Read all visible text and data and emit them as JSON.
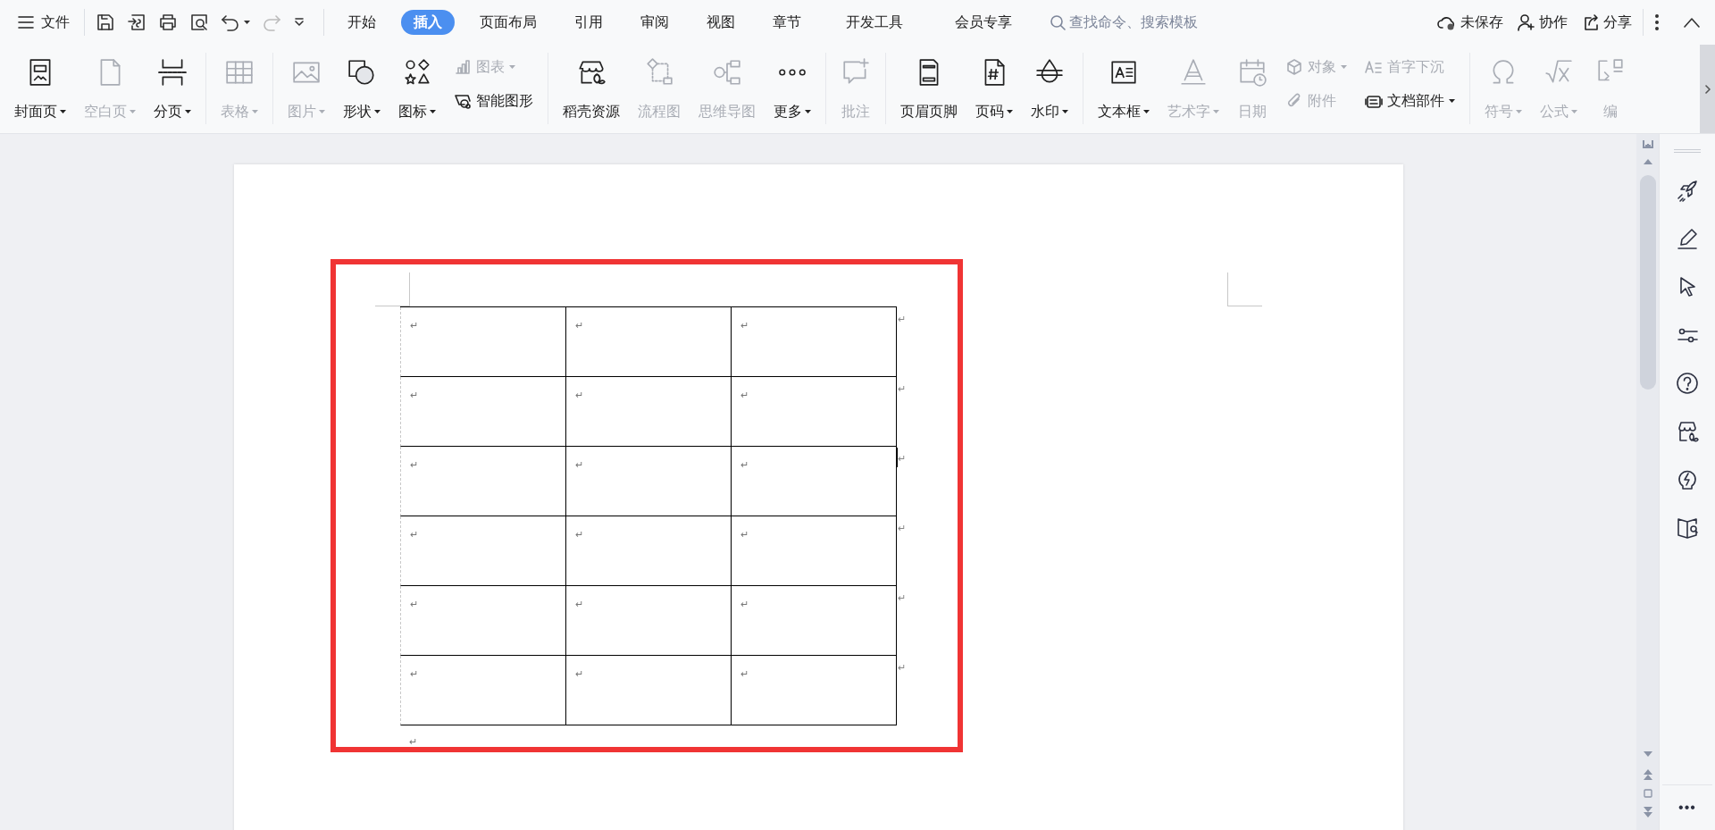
{
  "title_bar": {
    "file_menu": "文件",
    "tabs": [
      {
        "label": "开始",
        "selected": false
      },
      {
        "label": "插入",
        "selected": true
      },
      {
        "label": "页面布局",
        "selected": false
      },
      {
        "label": "引用",
        "selected": false
      },
      {
        "label": "审阅",
        "selected": false
      },
      {
        "label": "视图",
        "selected": false
      },
      {
        "label": "章节",
        "selected": false
      },
      {
        "label": "开发工具",
        "selected": false
      },
      {
        "label": "会员专享",
        "selected": false
      }
    ],
    "search": {
      "placeholder": "查找命令、搜索模板"
    },
    "actions": [
      "未保存",
      "协作",
      "分享"
    ]
  },
  "ribbon": {
    "groups": [
      {
        "items": [
          {
            "kind": "large",
            "label": "封面页",
            "dropdown": true,
            "disabled": false
          },
          {
            "kind": "large",
            "label": "空白页",
            "dropdown": true,
            "disabled": true
          },
          {
            "kind": "large",
            "label": "分页",
            "dropdown": true,
            "disabled": false
          }
        ]
      },
      {
        "items": [
          {
            "kind": "large",
            "label": "表格",
            "dropdown": true,
            "disabled": true
          }
        ]
      },
      {
        "items": [
          {
            "kind": "large",
            "label": "图片",
            "dropdown": true,
            "disabled": true
          },
          {
            "kind": "large",
            "label": "形状",
            "dropdown": true,
            "disabled": false
          },
          {
            "kind": "large",
            "label": "图标",
            "dropdown": true,
            "disabled": false
          },
          {
            "kind": "stack",
            "items": [
              {
                "label": "图表",
                "dropdown": true,
                "disabled": true
              },
              {
                "label": "智能图形",
                "dropdown": false,
                "disabled": false
              }
            ]
          }
        ]
      },
      {
        "items": [
          {
            "kind": "large",
            "label": "稻壳资源",
            "dropdown": false,
            "disabled": false
          },
          {
            "kind": "large",
            "label": "流程图",
            "dropdown": false,
            "disabled": true
          },
          {
            "kind": "large",
            "label": "思维导图",
            "dropdown": false,
            "disabled": true
          },
          {
            "kind": "large",
            "label": "更多",
            "dropdown": true,
            "disabled": false
          }
        ]
      },
      {
        "items": [
          {
            "kind": "large",
            "label": "批注",
            "dropdown": false,
            "disabled": true
          }
        ]
      },
      {
        "items": [
          {
            "kind": "large",
            "label": "页眉页脚",
            "dropdown": false,
            "disabled": false
          },
          {
            "kind": "large",
            "label": "页码",
            "dropdown": true,
            "disabled": false
          },
          {
            "kind": "large",
            "label": "水印",
            "dropdown": true,
            "disabled": false
          }
        ]
      },
      {
        "items": [
          {
            "kind": "large",
            "label": "文本框",
            "dropdown": true,
            "disabled": false
          },
          {
            "kind": "large",
            "label": "艺术字",
            "dropdown": true,
            "disabled": true
          },
          {
            "kind": "large",
            "label": "日期",
            "dropdown": false,
            "disabled": true
          },
          {
            "kind": "stack",
            "items": [
              {
                "label": "对象",
                "dropdown": true,
                "disabled": true
              },
              {
                "label": "附件",
                "dropdown": false,
                "disabled": true
              }
            ]
          },
          {
            "kind": "stack",
            "items": [
              {
                "label": "首字下沉",
                "dropdown": false,
                "disabled": true
              },
              {
                "label": "文档部件",
                "dropdown": true,
                "disabled": false
              }
            ]
          }
        ]
      },
      {
        "items": [
          {
            "kind": "large",
            "label": "符号",
            "dropdown": true,
            "disabled": true
          },
          {
            "kind": "large",
            "label": "公式",
            "dropdown": true,
            "disabled": true
          },
          {
            "kind": "large",
            "label": "编",
            "dropdown": false,
            "disabled": true
          }
        ]
      }
    ]
  },
  "document": {
    "table": {
      "rows": [
        {
          "cells": [
            "↵",
            "↵",
            "↵"
          ],
          "end_mark": "↵"
        },
        {
          "cells": [
            "↵",
            "↵",
            "↵"
          ],
          "end_mark": "↵"
        },
        {
          "cells": [
            "↵",
            "↵",
            "↵"
          ],
          "end_mark": "↵"
        },
        {
          "cells": [
            "↵",
            "↵",
            "↵"
          ],
          "end_mark": "↵"
        },
        {
          "cells": [
            "↵",
            "↵",
            "↵"
          ],
          "end_mark": "↵"
        },
        {
          "cells": [
            "↵",
            "↵",
            "↵"
          ],
          "end_mark": "↵"
        }
      ]
    },
    "paragraph_mark": "↵"
  },
  "side_panel": {
    "more": "•••"
  }
}
